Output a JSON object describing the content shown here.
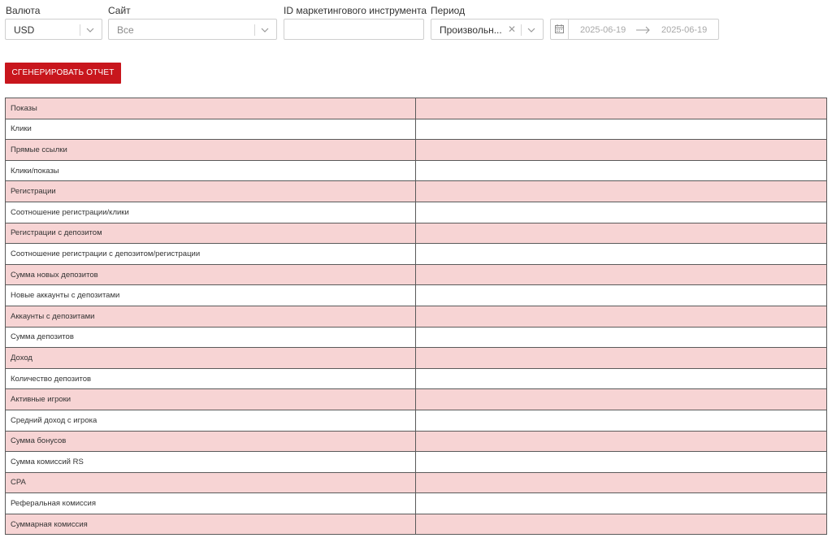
{
  "filters": {
    "currency": {
      "label": "Валюта",
      "value": "USD"
    },
    "site": {
      "label": "Сайт",
      "value": "Все"
    },
    "marketing_id": {
      "label": "ID маркетингового инструмента",
      "value": ""
    },
    "period": {
      "label": "Период",
      "value": "Произвольн..."
    },
    "date_range": {
      "start": "2025-06-19",
      "end": "2025-06-19"
    }
  },
  "generate_button": {
    "label": "СГЕНЕРИРОВАТЬ ОТЧЕТ"
  },
  "colors": {
    "accent": "#c8161d",
    "row_shade": "#f7d4d4"
  },
  "table": {
    "rows": [
      {
        "label": "Показы",
        "value": ""
      },
      {
        "label": "Клики",
        "value": ""
      },
      {
        "label": "Прямые ссылки",
        "value": ""
      },
      {
        "label": "Клики/показы",
        "value": ""
      },
      {
        "label": "Регистрации",
        "value": ""
      },
      {
        "label": "Соотношение регистрации/клики",
        "value": ""
      },
      {
        "label": "Регистрации с депозитом",
        "value": ""
      },
      {
        "label": "Соотношение регистрации с депозитом/регистрации",
        "value": ""
      },
      {
        "label": "Сумма новых депозитов",
        "value": ""
      },
      {
        "label": "Новые аккаунты с депозитами",
        "value": ""
      },
      {
        "label": "Аккаунты с депозитами",
        "value": ""
      },
      {
        "label": "Сумма депозитов",
        "value": ""
      },
      {
        "label": "Доход",
        "value": ""
      },
      {
        "label": "Количество депозитов",
        "value": ""
      },
      {
        "label": "Активные игроки",
        "value": ""
      },
      {
        "label": "Средний доход с игрока",
        "value": ""
      },
      {
        "label": "Сумма бонусов",
        "value": ""
      },
      {
        "label": "Сумма комиссий RS",
        "value": ""
      },
      {
        "label": "CPA",
        "value": ""
      },
      {
        "label": "Реферальная комиссия",
        "value": ""
      },
      {
        "label": "Суммарная комиссия",
        "value": ""
      }
    ]
  }
}
